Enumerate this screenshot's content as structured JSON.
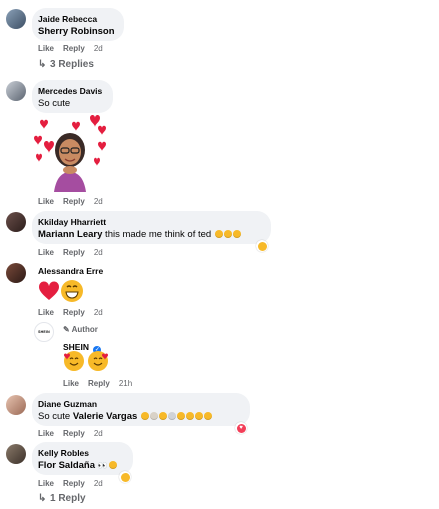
{
  "comments": [
    {
      "author": "Jaide Rebecca",
      "text_bold": "Sherry Robinson",
      "text": "",
      "like": "Like",
      "reply": "Reply",
      "time": "2d",
      "replies": "3 Replies"
    },
    {
      "author": "Mercedes Davis",
      "text": "So cute",
      "like": "Like",
      "reply": "Reply",
      "time": "2d"
    },
    {
      "author": "Kkilday Hharriett",
      "text_bold": "Mariann Leary",
      "text": " this made me think of ted",
      "like": "Like",
      "reply": "Reply",
      "time": "2d"
    },
    {
      "author": "Alessandra Erre",
      "like": "Like",
      "reply": "Reply",
      "time": "2d"
    },
    {
      "author_badge": "Author",
      "author": "SHEIN",
      "avatar_text": "SHEIN",
      "like": "Like",
      "reply": "Reply",
      "time": "21h"
    },
    {
      "author": "Diane Guzman",
      "text": "So cute ",
      "text_bold": "Valerie Vargas",
      "like": "Like",
      "reply": "Reply",
      "time": "2d"
    },
    {
      "author": "Kelly Robles",
      "text_bold": "Flor Saldaña",
      "like": "Like",
      "reply": "Reply",
      "time": "2d",
      "replies": "1 Reply"
    }
  ],
  "colors": {
    "bubble": "#f0f2f5",
    "meta": "#65676b",
    "verified": "#1877f2",
    "heart": "#e41e3f",
    "haha": "#f7b928"
  }
}
